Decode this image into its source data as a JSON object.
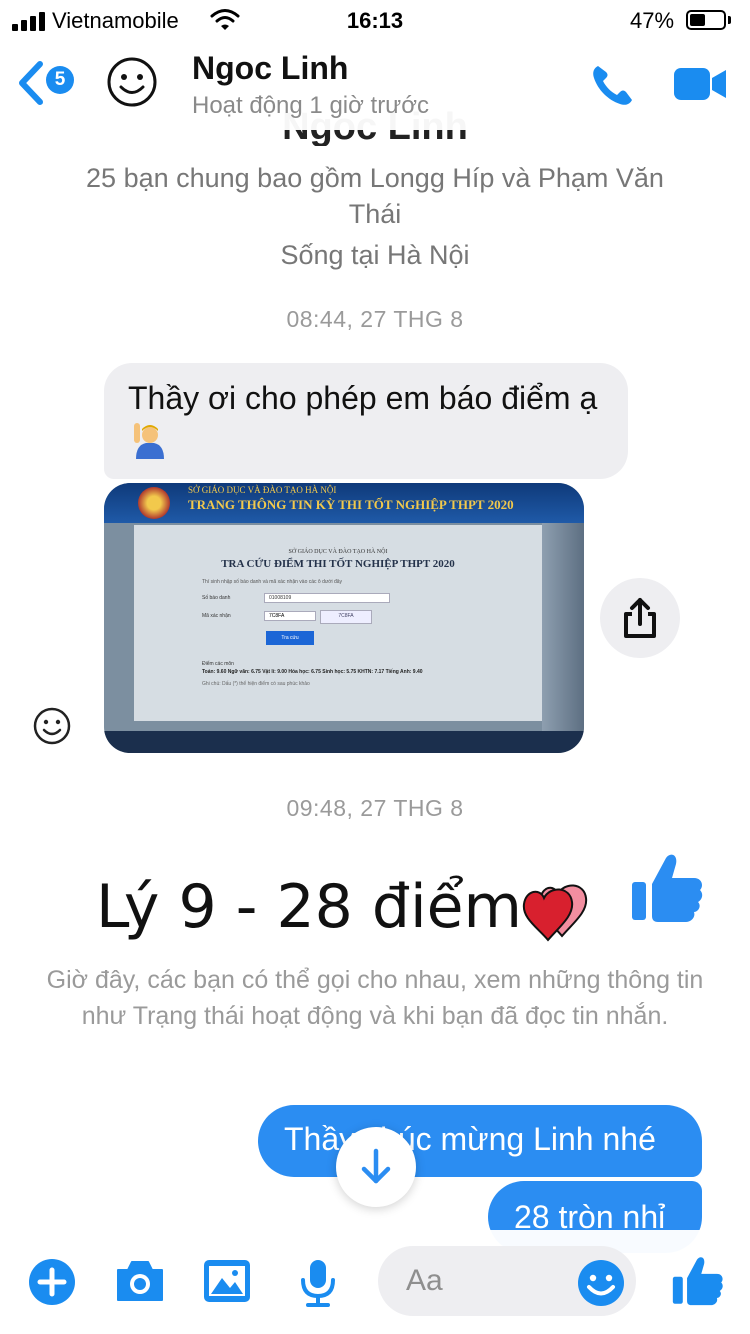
{
  "status_bar": {
    "carrier": "Vietnamobile",
    "time": "16:13",
    "battery_percent": "47%",
    "battery_level": 0.47
  },
  "header": {
    "unread_count": "5",
    "contact_name": "Ngoc Linh",
    "contact_status": "Hoạt động 1 giờ trước"
  },
  "profile": {
    "name": "Ngoc Linh",
    "mutual_friends": "25 bạn chung bao gồm Longg Híp và Phạm Văn Thái",
    "lives_in": "Sống tại Hà Nội"
  },
  "thread": {
    "timestamp_1": "08:44, 27 THG 8",
    "incoming_message": "Thầy ơi cho phép em báo điểm ạ",
    "photo": {
      "banner_line1": "SỞ GIÁO DỤC VÀ ĐÀO TẠO HÀ NỘI",
      "banner_line2": "TRANG THÔNG TIN KỲ THI TỐT NGHIỆP THPT 2020",
      "heading_small": "SỞ GIÁO DỤC VÀ ĐÀO TẠO HÀ NỘI",
      "heading": "TRA CỨU ĐIỂM THI TỐT NGHIỆP THPT 2020",
      "sbd_value": "01008109",
      "captcha_value": "7C8FA",
      "lookup_button": "Tra cứu",
      "results": "Toán: 9.60   Ngữ văn: 6.75   Vật lí: 9.00   Hóa học: 6.75   Sinh học: 5.75   KHTN: 7.17   Tiếng Anh: 9.40"
    },
    "timestamp_2": "09:48, 27 THG 8",
    "caption": "Lý 9 - 28 điểm",
    "info_text": "Giờ đây, các bạn có thể gọi cho nhau, xem những thông tin như Trạng thái hoạt động và khi bạn đã đọc tin nhắn.",
    "outgoing_1": "Thầy chúc mừng Linh nhé",
    "outgoing_2": "28 tròn nhỉ"
  },
  "composer": {
    "placeholder": "Aa"
  },
  "colors": {
    "accent": "#1a8cf0",
    "bubble_out": "#2b8df2",
    "bubble_in": "#eeeef1",
    "muted_text": "#9a9a9a"
  },
  "icons": [
    "back-chevron-icon",
    "avatar-smiley-icon",
    "phone-icon",
    "video-camera-icon",
    "raise-hand-emoji-icon",
    "share-icon",
    "smiley-react-icon",
    "hearts-icon",
    "thumbs-up-icon",
    "arrow-down-icon",
    "plus-icon",
    "camera-icon",
    "gallery-icon",
    "microphone-icon",
    "emoji-icon"
  ]
}
